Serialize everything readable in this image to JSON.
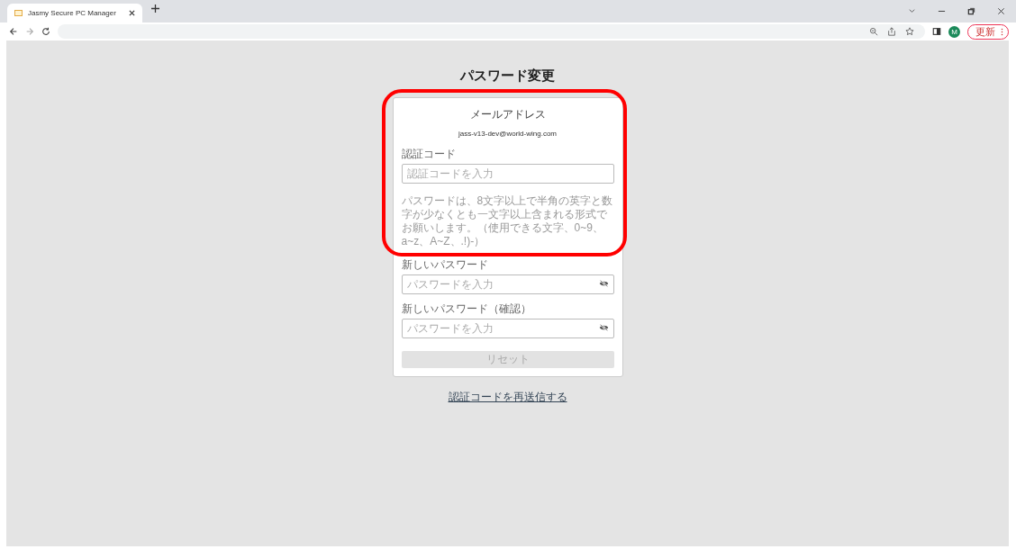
{
  "browser": {
    "tabs": [
      {
        "title": "Jasmy Secure PC Manager",
        "selected": true
      }
    ],
    "avatar": "M",
    "update_button": "更新"
  },
  "page": {
    "title": "パスワード変更",
    "card": {
      "email_label": "メールアドレス",
      "email": "jass-v13-dev@world-wing.com",
      "fields": [
        {
          "kind": "text",
          "label": "認証コード",
          "placeholder": "認証コードを入力"
        },
        {
          "kind": "hint",
          "text": "パスワードは、8文字以上で半角の英字と数字が少なくとも一文字以上含まれる形式でお願いします。（使用できる文字、0~9、a~z、A~Z、.!)-）"
        },
        {
          "kind": "password",
          "label": "新しいパスワード",
          "placeholder": "パスワードを入力"
        },
        {
          "kind": "password",
          "label": "新しいパスワード（確認）",
          "placeholder": "パスワードを入力"
        }
      ],
      "submit": {
        "label": "リセット",
        "disabled": true
      }
    },
    "resend_link": "認証コードを再送信する"
  }
}
